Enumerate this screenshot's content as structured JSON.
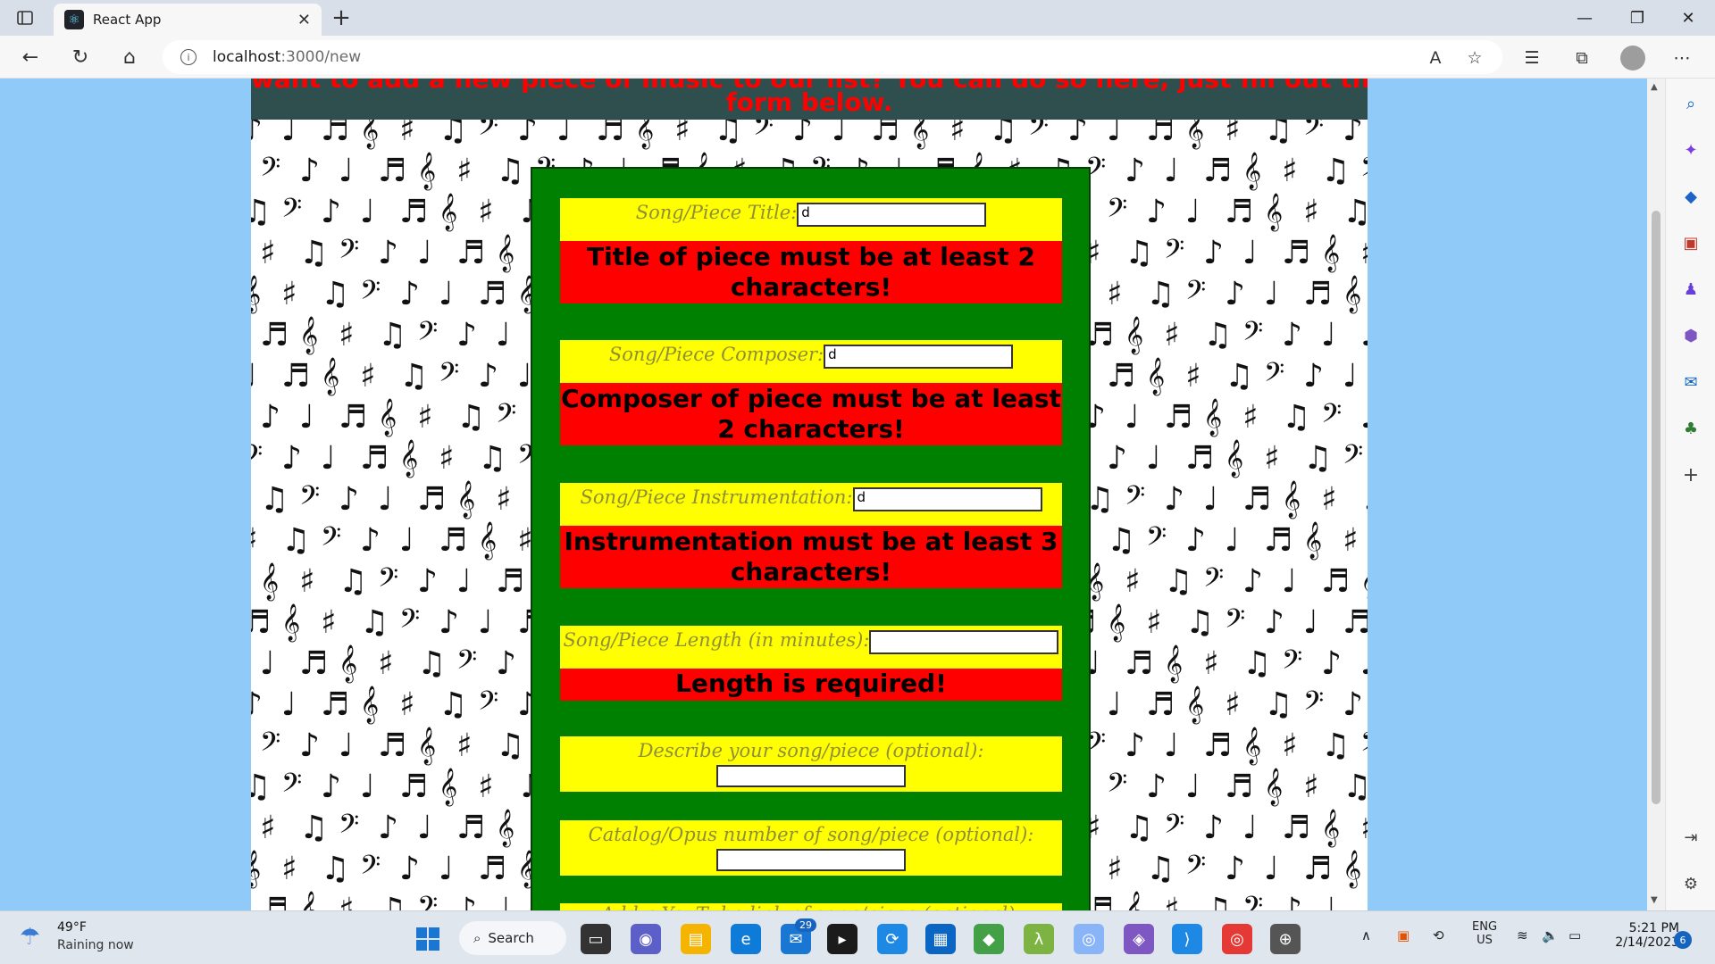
{
  "browser": {
    "tab_title": "React App",
    "url_host": "localhost",
    "url_path": ":3000/new"
  },
  "page": {
    "header_partial": "want to add a new piece of music to our list? You can do so here, just fill out the",
    "header_tail": "form below.",
    "fields": {
      "title": {
        "label": "Song/Piece Title:",
        "value": "d",
        "error": "Title of piece must be at least 2 characters!"
      },
      "composer": {
        "label": "Song/Piece Composer:",
        "value": "d",
        "error": "Composer of piece must be at least 2 characters!"
      },
      "instrumentation": {
        "label": "Song/Piece Instrumentation:",
        "value": "d",
        "error": "Instrumentation must be at least 3 characters!"
      },
      "length": {
        "label": "Song/Piece Length (in minutes):",
        "value": "",
        "error": "Length is required!"
      },
      "description": {
        "label": "Describe your song/piece (optional):",
        "value": ""
      },
      "catalog": {
        "label": "Catalog/Opus number of song/piece (optional):",
        "value": ""
      },
      "youtube": {
        "label": "Add a YouTube link of song/piece (optional):"
      }
    }
  },
  "taskbar": {
    "weather_temp": "49°F",
    "weather_desc": "Raining now",
    "search_label": "Search",
    "mail_badge": "29",
    "lang": "ENG",
    "region": "US",
    "time": "5:21 PM",
    "date": "2/14/2023",
    "notifications": "6"
  }
}
